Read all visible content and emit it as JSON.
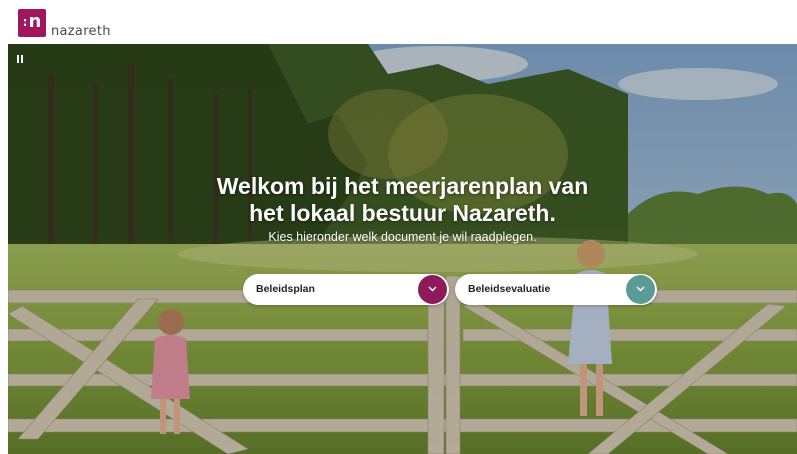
{
  "brand": {
    "logo_mark": "n",
    "logo_text": "nazareth",
    "color": "#a1165e"
  },
  "hero": {
    "title_line1": "Welkom bij het meerjarenplan van",
    "title_line2": "het lokaal bestuur Nazareth.",
    "subtitle": "Kies hieronder welk document je wil raadplegen.",
    "pause_icon": "pause-icon"
  },
  "documents": [
    {
      "label": "Beleidsplan",
      "color": "#8e1a5c",
      "icon": "chevron-down-icon"
    },
    {
      "label": "Beleidsevaluatie",
      "color": "#5a9c95",
      "icon": "chevron-down-icon"
    }
  ]
}
